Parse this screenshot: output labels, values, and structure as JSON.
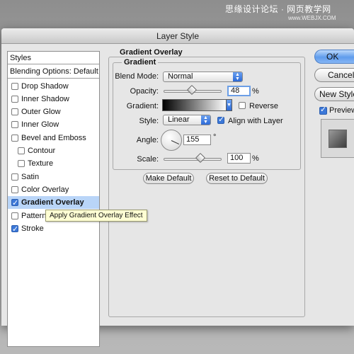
{
  "watermark": {
    "text": "思缘设计论坛 · 网页教学网",
    "url": "www.WEBJX.COM"
  },
  "window": {
    "title": "Layer Style"
  },
  "styles_panel": {
    "header": "Styles",
    "blending_options": "Blending Options: Default",
    "items": [
      {
        "label": "Drop Shadow",
        "checked": false
      },
      {
        "label": "Inner Shadow",
        "checked": false
      },
      {
        "label": "Outer Glow",
        "checked": false
      },
      {
        "label": "Inner Glow",
        "checked": false
      },
      {
        "label": "Bevel and Emboss",
        "checked": false
      },
      {
        "label": "Contour",
        "checked": false
      },
      {
        "label": "Texture",
        "checked": false
      },
      {
        "label": "Satin",
        "checked": false
      },
      {
        "label": "Color Overlay",
        "checked": false
      },
      {
        "label": "Gradient Overlay",
        "checked": true,
        "selected": true
      },
      {
        "label": "Pattern Overlay",
        "checked": false
      },
      {
        "label": "Stroke",
        "checked": true
      }
    ]
  },
  "tooltip": "Apply Gradient Overlay Effect",
  "gradient_overlay": {
    "group_title": "Gradient Overlay",
    "subgroup_title": "Gradient",
    "blend_mode_label": "Blend Mode:",
    "blend_mode_value": "Normal",
    "opacity_label": "Opacity:",
    "opacity_value": "48",
    "opacity_unit": "%",
    "gradient_label": "Gradient:",
    "reverse_label": "Reverse",
    "reverse_checked": false,
    "style_label": "Style:",
    "style_value": "Linear",
    "align_label": "Align with Layer",
    "align_checked": true,
    "angle_label": "Angle:",
    "angle_value": "155",
    "angle_unit": "°",
    "scale_label": "Scale:",
    "scale_value": "100",
    "scale_unit": "%",
    "make_default": "Make Default",
    "reset_default": "Reset to Default"
  },
  "right_buttons": {
    "ok": "OK",
    "cancel": "Cancel",
    "new_style": "New Style...",
    "preview_label": "Preview",
    "preview_checked": true
  },
  "colors": {
    "accent": "#3c78d8",
    "selection": "#b9d5f8",
    "tooltip_bg": "#fefed3"
  }
}
